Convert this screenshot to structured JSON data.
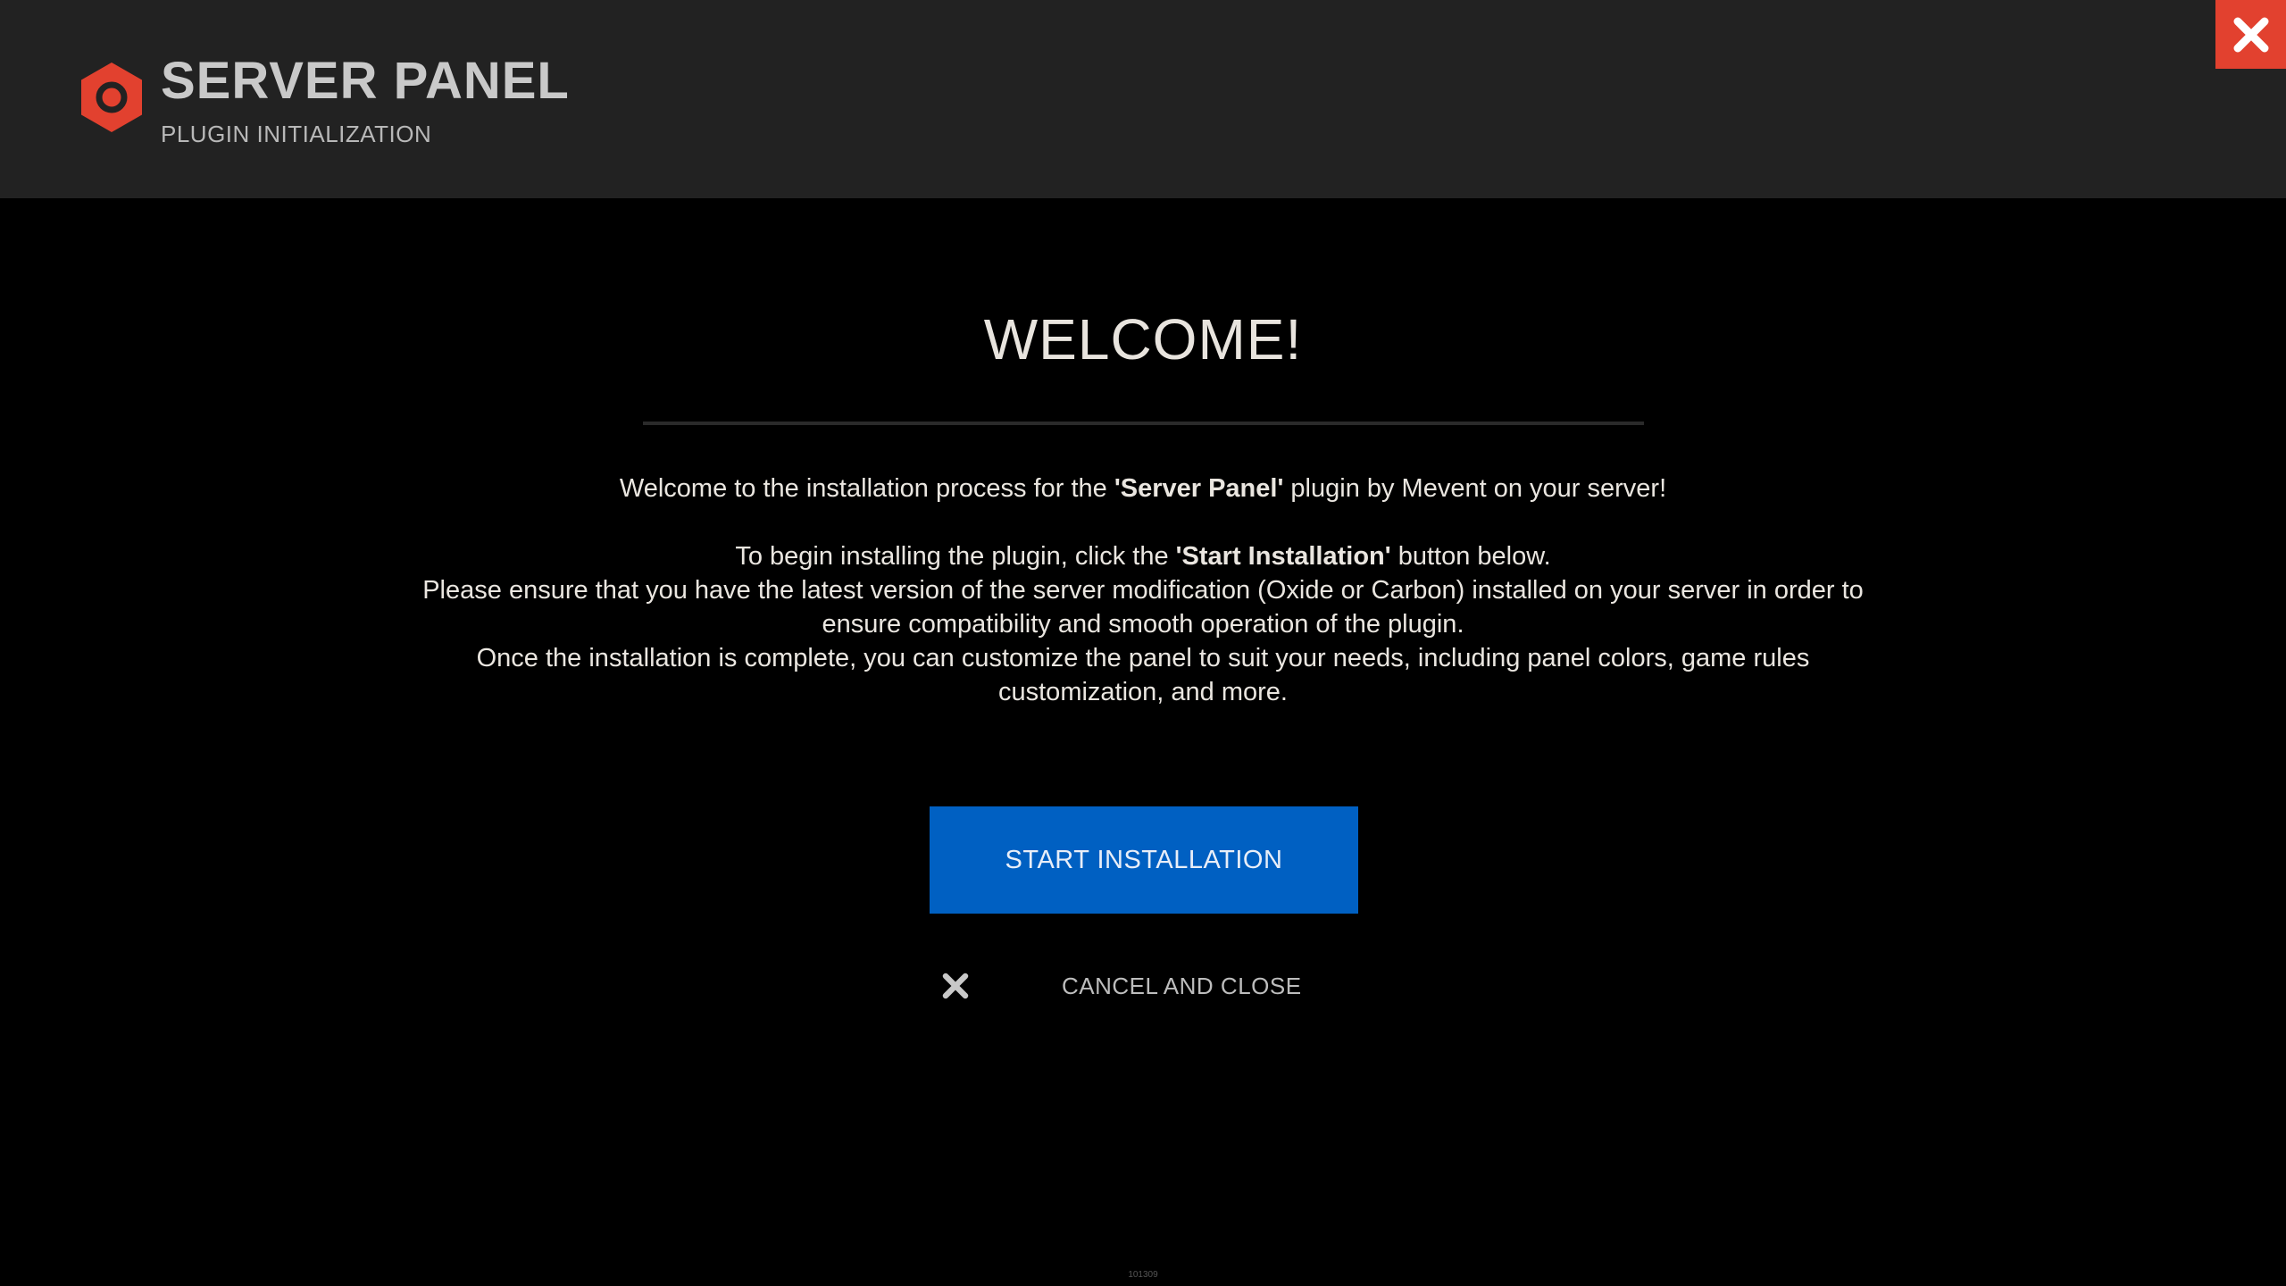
{
  "header": {
    "title": "SERVER PANEL",
    "subtitle": "PLUGIN INITIALIZATION",
    "logo_icon": "hexagon-nut-icon",
    "close_icon": "close-icon"
  },
  "main": {
    "welcome_title": "WELCOME!",
    "intro_prefix": "Welcome to the installation process for the ",
    "intro_bold": "'Server Panel'",
    "intro_suffix": " plugin by Mevent on your server!",
    "instr_prefix": "To begin installing the plugin, click the ",
    "instr_bold": "'Start Installation'",
    "instr_suffix": " button below.",
    "line_ensure": "Please ensure that you have the latest version of the server modification (Oxide or Carbon) installed on your server in order to ensure compatibility and smooth operation of the plugin.",
    "line_customize": "Once the installation is complete, you can customize the panel to suit your needs, including panel colors, game rules customization, and more.",
    "start_button": "START INSTALLATION",
    "cancel_button": "CANCEL AND CLOSE",
    "cancel_icon": "close-icon"
  },
  "footer": {
    "id_text": "101309"
  },
  "colors": {
    "header_bg": "#222222",
    "accent_red": "#e2412f",
    "button_blue": "#0060c2",
    "page_bg": "#000000"
  }
}
